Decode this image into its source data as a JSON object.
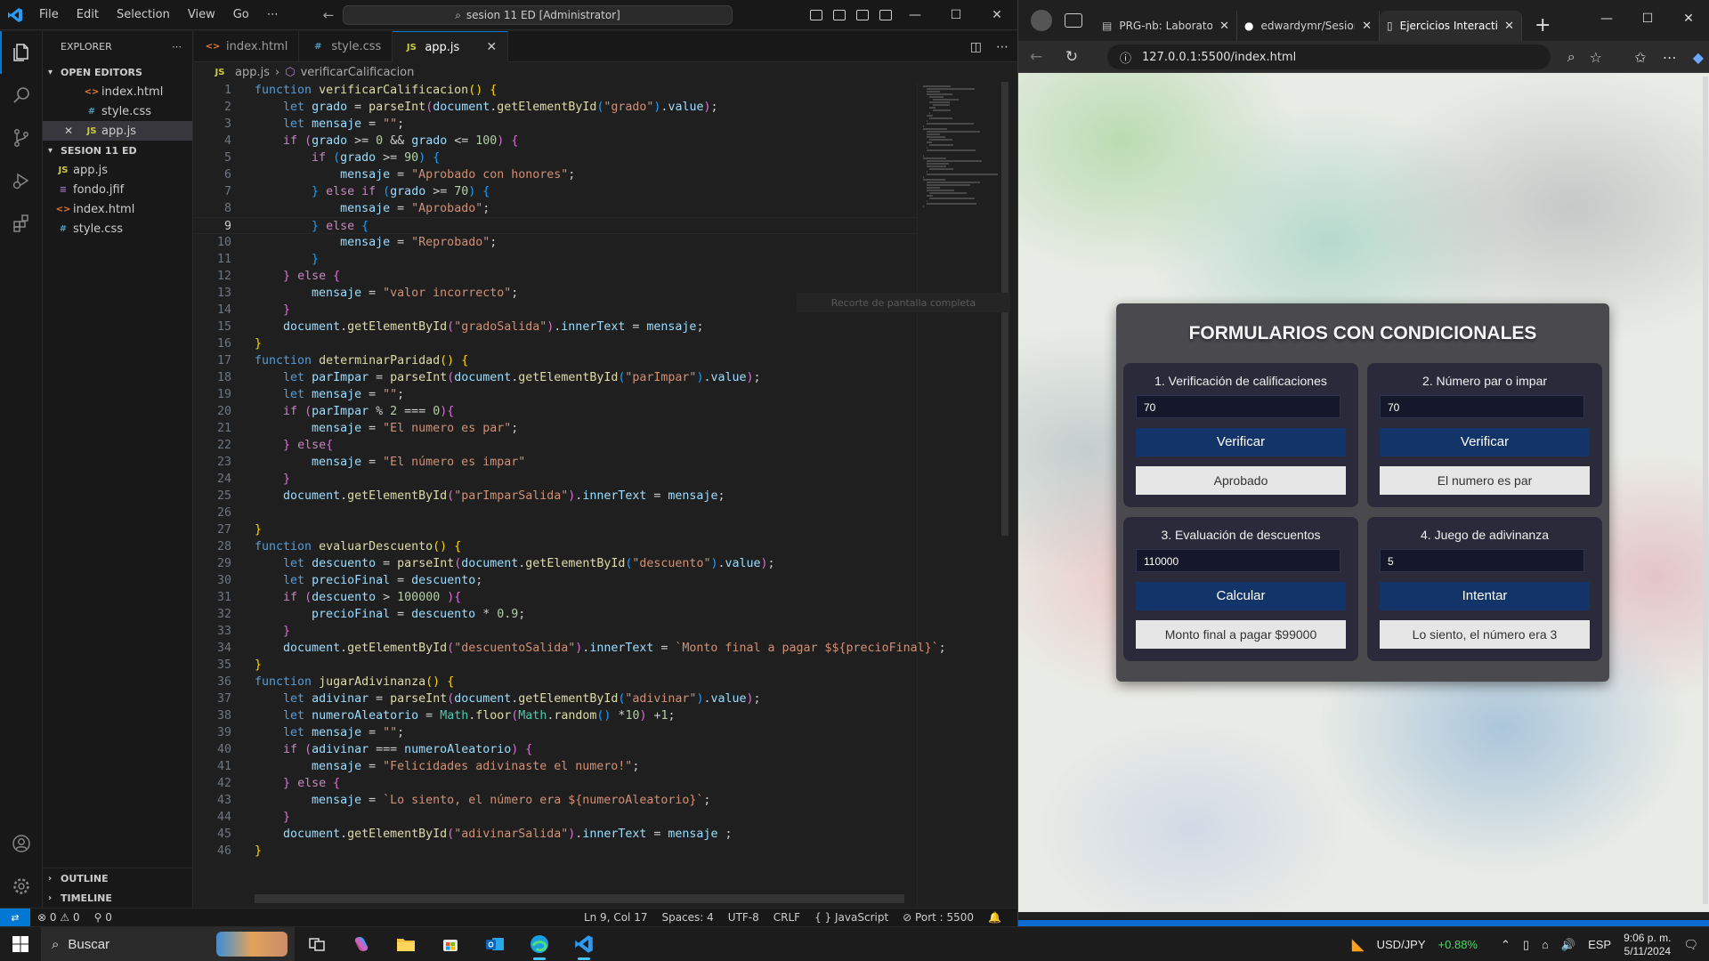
{
  "vscode": {
    "menu": [
      "File",
      "Edit",
      "Selection",
      "View",
      "Go"
    ],
    "more": "⋯",
    "command_center": "sesion 11 ED [Administrator]",
    "explorer": {
      "title": "EXPLORER",
      "more": "⋯",
      "open_editors_label": "OPEN EDITORS",
      "open_editors": [
        {
          "name": "index.html",
          "type": "html",
          "icon": "<>"
        },
        {
          "name": "style.css",
          "type": "css",
          "icon": "#"
        },
        {
          "name": "app.js",
          "type": "js",
          "icon": "JS"
        }
      ],
      "folder_label": "SESION 11 ED",
      "files": [
        {
          "name": "app.js",
          "type": "js",
          "icon": "JS"
        },
        {
          "name": "fondo.jfif",
          "type": "img",
          "icon": "≡"
        },
        {
          "name": "index.html",
          "type": "html",
          "icon": "<>"
        },
        {
          "name": "style.css",
          "type": "css",
          "icon": "#"
        }
      ],
      "outline_label": "OUTLINE",
      "timeline_label": "TIMELINE"
    },
    "tabs": [
      {
        "label": "index.html",
        "icon": "<>"
      },
      {
        "label": "style.css",
        "icon": "#"
      },
      {
        "label": "app.js",
        "icon": "JS"
      }
    ],
    "breadcrumb": {
      "file": "app.js",
      "symbol": "verificarCalificacion"
    },
    "toast": "Recorte de pantalla completa",
    "code_lines": [
      "function verificarCalificacion() {",
      "    let grado = parseInt(document.getElementById(\"grado\").value);",
      "    let mensaje = \"\";",
      "    if (grado >= 0 && grado <= 100) {",
      "        if (grado >= 90) {",
      "            mensaje = \"Aprobado con honores\";",
      "        } else if (grado >= 70) {",
      "            mensaje = \"Aprobado\";",
      "        } else {",
      "            mensaje = \"Reprobado\";",
      "        }",
      "    } else {",
      "        mensaje = \"valor incorrecto\";",
      "    }",
      "    document.getElementById(\"gradoSalida\").innerText = mensaje;",
      "}",
      "function determinarParidad() {",
      "    let parImpar = parseInt(document.getElementById(\"parImpar\").value);",
      "    let mensaje = \"\";",
      "    if (parImpar % 2 === 0){",
      "        mensaje = \"El numero es par\";",
      "    } else{",
      "        mensaje = \"El número es impar\"",
      "    }",
      "    document.getElementById(\"parImparSalida\").innerText = mensaje;",
      "",
      "}",
      "function evaluarDescuento() {",
      "    let descuento = parseInt(document.getElementById(\"descuento\").value);",
      "    let precioFinal = descuento;",
      "    if (descuento > 100000 ){",
      "        precioFinal = descuento * 0.9;",
      "    }",
      "    document.getElementById(\"descuentoSalida\").innerText = `Monto final a pagar $${precioFinal}`;",
      "}",
      "function jugarAdivinanza() {",
      "    let adivinar = parseInt(document.getElementById(\"adivinar\").value);",
      "    let numeroAleatorio = Math.floor(Math.random() *10) +1;",
      "    let mensaje = \"\";",
      "    if (adivinar === numeroAleatorio) {",
      "        mensaje = \"Felicidades adivinaste el numero!\";",
      "    } else {",
      "        mensaje = `Lo siento, el número era ${numeroAleatorio}`;",
      "    }",
      "    document.getElementById(\"adivinarSalida\").innerText = mensaje ;",
      "}"
    ],
    "current_line": 9,
    "status": {
      "errors": "0",
      "warnings": "0",
      "ports": "0",
      "position": "Ln 9, Col 17",
      "spaces": "Spaces: 4",
      "encoding": "UTF-8",
      "eol": "CRLF",
      "language": "JavaScript",
      "port": "Port : 5500"
    }
  },
  "browser": {
    "tabs": [
      {
        "title": "PRG-nb: Laboratorio",
        "icon": "page-icon"
      },
      {
        "title": "edwardymr/Sesion",
        "icon": "github-icon"
      },
      {
        "title": "Ejercicios Interactivos",
        "icon": "page-icon"
      }
    ],
    "url": "127.0.0.1:5500/index.html",
    "page": {
      "title": "FORMULARIOS CON CONDICIONALES",
      "cards": [
        {
          "heading": "1. Verificación de calificaciones",
          "input": "70",
          "button": "Verificar",
          "output": "Aprobado"
        },
        {
          "heading": "2. Número par o impar",
          "input": "70",
          "button": "Verificar",
          "output": "El numero es par"
        },
        {
          "heading": "3. Evaluación de descuentos",
          "input": "110000",
          "button": "Calcular",
          "output": "Monto final a pagar $99000"
        },
        {
          "heading": "4. Juego de adivinanza",
          "input": "5",
          "button": "Intentar",
          "output": "Lo siento, el número era 3"
        }
      ]
    }
  },
  "taskbar": {
    "search_placeholder": "Buscar",
    "ticker": "USD/JPY",
    "ticker_change": "+0.88%",
    "ticker_color": "#4cd964",
    "lang": "ESP",
    "time": "9:06 p. m.",
    "date": "5/11/2024"
  },
  "colors": {
    "vscode_accent": "#0078d4",
    "panel_bg": "#4a4a4e",
    "card_bg": "#2a2a3a",
    "button_bg": "#123468"
  }
}
